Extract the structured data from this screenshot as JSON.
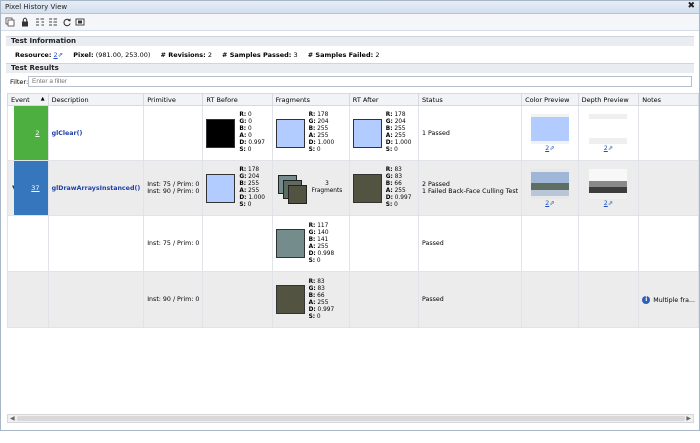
{
  "window": {
    "title": "Pixel History View",
    "close": "✖"
  },
  "sections": {
    "test_info": "Test Information",
    "test_results": "Test Results"
  },
  "info": {
    "resource_label": "Resource:",
    "resource_value": "2",
    "pixel_label": "Pixel:",
    "pixel_value": "(981.00, 253.00)",
    "revisions_label": "# Revisions:",
    "revisions_value": "2",
    "passed_label": "# Samples Passed:",
    "passed_value": "3",
    "failed_label": "# Samples Failed:",
    "failed_value": "2"
  },
  "filter": {
    "label": "Filter:",
    "placeholder": "Enter a filter"
  },
  "columns": [
    "Event",
    "Description",
    "Primitive",
    "RT Before",
    "Fragments",
    "RT After",
    "Status",
    "Color Preview",
    "Depth Preview",
    "Notes"
  ],
  "rows": [
    {
      "event": "2",
      "event_color": "#4caf3f",
      "desc": "glClear()",
      "primitive": "",
      "before": {
        "color": "#000000",
        "r": "0",
        "g": "0",
        "b": "0",
        "a": "0",
        "d": "0.997",
        "s": "0"
      },
      "frag": {
        "color": "#b2ccff",
        "r": "178",
        "g": "204",
        "b": "255",
        "a": "255",
        "d": "1.000",
        "s": "0"
      },
      "after": {
        "color": "#b2ccff",
        "r": "178",
        "g": "204",
        "b": "255",
        "a": "255",
        "d": "1.000",
        "s": "0"
      },
      "status1": "1 Passed",
      "status2": "",
      "color_link": "2",
      "depth_link": "2",
      "notes": ""
    },
    {
      "event": "37",
      "event_color": "#3576bd",
      "desc": "glDrawArraysInstanced()",
      "primitive": "Inst: 75 / Prim: 0",
      "primitive2": "Inst: 90 / Prim: 0",
      "before": {
        "color": "#b2ccff",
        "r": "178",
        "g": "204",
        "b": "255",
        "a": "255",
        "d": "1.000",
        "s": "0"
      },
      "frag_count": "3",
      "frag_label": "Fragments",
      "after": {
        "color": "#535342",
        "r": "83",
        "g": "83",
        "b": "66",
        "a": "255",
        "d": "0.997",
        "s": "0"
      },
      "status1": "2 Passed",
      "status2": "1 Failed Back-Face Culling Test",
      "color_link": "2",
      "depth_link": "2",
      "notes": ""
    },
    {
      "primitive": "Inst: 75 / Prim: 0",
      "frag": {
        "color": "#758c8d",
        "r": "117",
        "g": "140",
        "b": "141",
        "a": "255",
        "d": "0.998",
        "s": "0"
      },
      "status1": "Passed"
    },
    {
      "primitive": "Inst: 90 / Prim: 0",
      "frag": {
        "color": "#535342",
        "r": "83",
        "g": "83",
        "b": "66",
        "a": "255",
        "d": "0.997",
        "s": "0"
      },
      "status1": "Passed",
      "notes": "Multiple fra..."
    }
  ]
}
